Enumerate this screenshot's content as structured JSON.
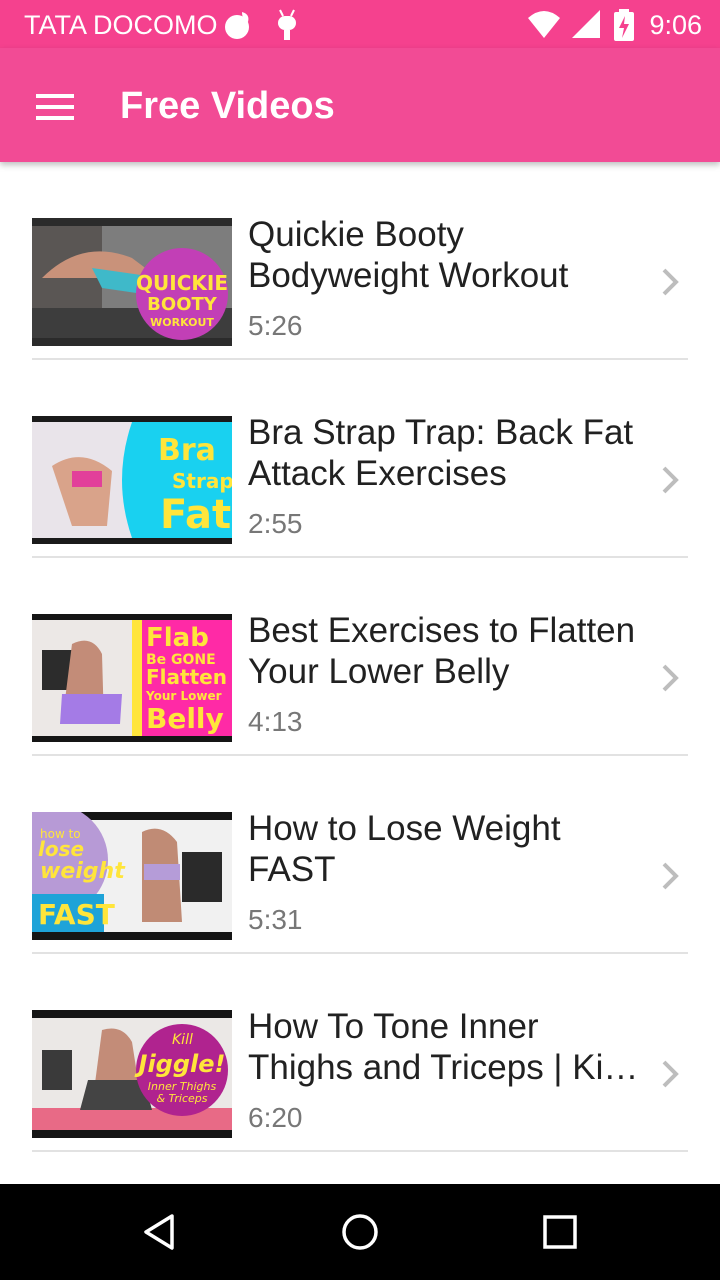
{
  "status_bar": {
    "carrier": "TATA DOCOMO",
    "time": "9:06"
  },
  "app_bar": {
    "title": "Free Videos"
  },
  "videos": [
    {
      "title": "Quickie Booty Bodyweight Workout",
      "duration": "5:26",
      "thumb_text": "QUICKIE BOOTY WORKOUT"
    },
    {
      "title": "Bra Strap Trap: Back Fat Attack Exercises",
      "duration": "2:55",
      "thumb_text": "Bra Strap Fat"
    },
    {
      "title": "Best Exercises to Flatten Your Lower Belly",
      "duration": "4:13",
      "thumb_text": "Flab Be GONE Flatten Your Lower Belly"
    },
    {
      "title": "How to Lose Weight FAST",
      "duration": "5:31",
      "thumb_text": "how to lose weight FAST"
    },
    {
      "title": "How To Tone Inner Thighs and Triceps | Ki…",
      "duration": "6:20",
      "thumb_text": "Kill the Jiggle! Inner Thighs & Triceps"
    }
  ]
}
